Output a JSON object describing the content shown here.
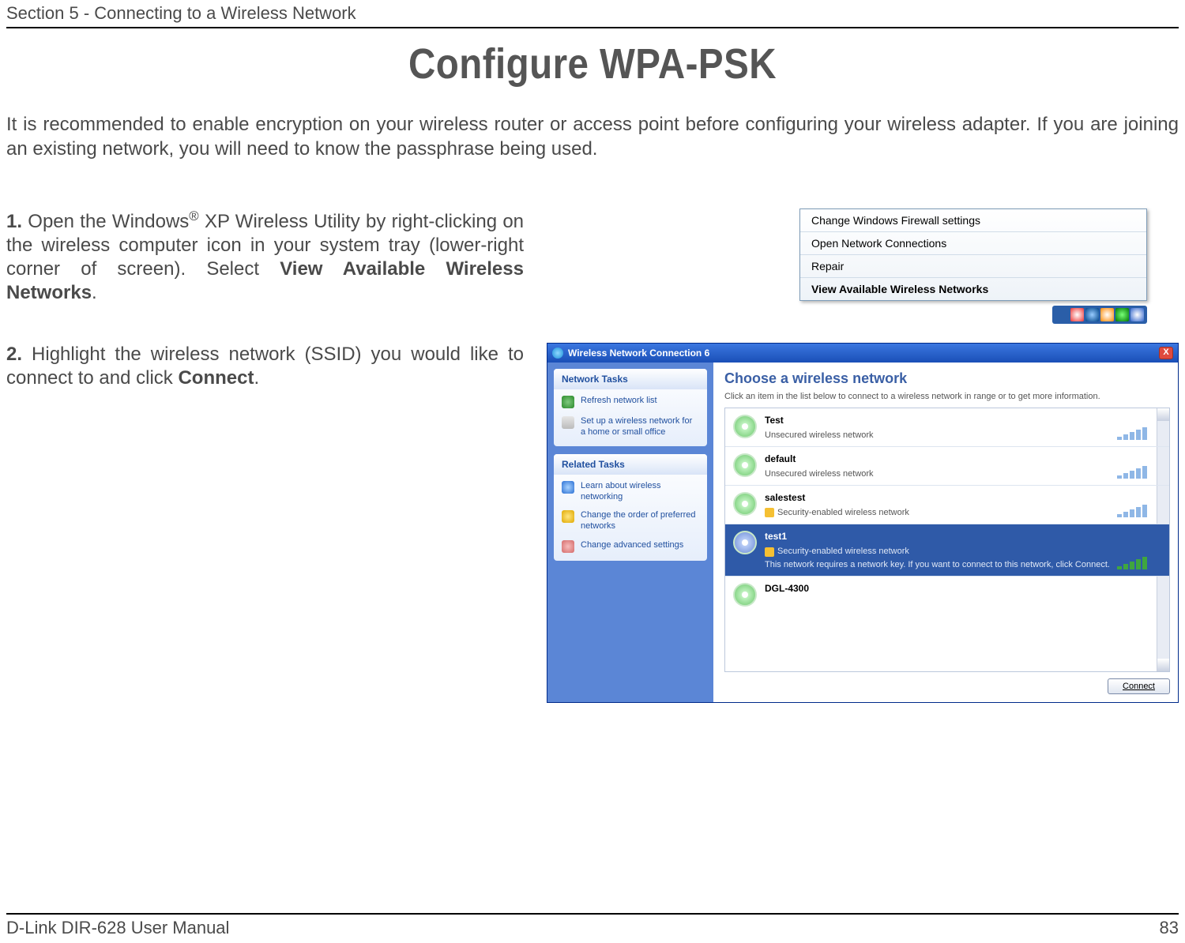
{
  "header": {
    "section": "Section 5 - Connecting to a Wireless Network"
  },
  "title": "Configure WPA-PSK",
  "intro": "It is recommended to enable encryption on your wireless router or access point before configuring your wireless adapter. If you are joining an existing network, you will need to know the passphrase being used.",
  "steps": {
    "s1_num": "1.",
    "s1_a": " Open the Windows",
    "s1_reg": "®",
    "s1_b": " XP Wireless Utility by right-clicking on the wireless computer icon in your system tray (lower-right corner of screen). Select ",
    "s1_bold": "View Available Wireless Networks",
    "s1_c": ".",
    "s2_num": "2.",
    "s2_a": " Highlight the wireless network (SSID) you would like to connect to and click ",
    "s2_bold": "Connect",
    "s2_c": "."
  },
  "ctx": {
    "i1": "Change Windows Firewall settings",
    "i2": "Open Network Connections",
    "i3": "Repair",
    "i4": "View Available Wireless Networks"
  },
  "win": {
    "title": "Wireless Network Connection 6",
    "close": "X",
    "task_hdr1": "Network Tasks",
    "task_hdr2": "Related Tasks",
    "link_refresh": "Refresh network list",
    "link_setup": "Set up a wireless network for a home or small office",
    "link_learn": "Learn about wireless networking",
    "link_order": "Change the order of preferred networks",
    "link_adv": "Change advanced settings",
    "choose": "Choose a wireless network",
    "sub": "Click an item in the list below to connect to a wireless network in range or to get more information.",
    "nets": [
      {
        "ssid": "Test",
        "status": "Unsecured wireless network",
        "secure": false
      },
      {
        "ssid": "default",
        "status": "Unsecured wireless network",
        "secure": false
      },
      {
        "ssid": "salestest",
        "status": "Security-enabled wireless network",
        "secure": true
      },
      {
        "ssid": "test1",
        "status": "Security-enabled wireless network",
        "secure": true,
        "extra": "This network requires a network key. If you want to connect to this network, click Connect."
      },
      {
        "ssid": "DGL-4300",
        "status": "",
        "secure": false
      }
    ],
    "connect_btn": "Connect"
  },
  "footer": {
    "left": "D-Link DIR-628 User Manual",
    "right": "83"
  }
}
